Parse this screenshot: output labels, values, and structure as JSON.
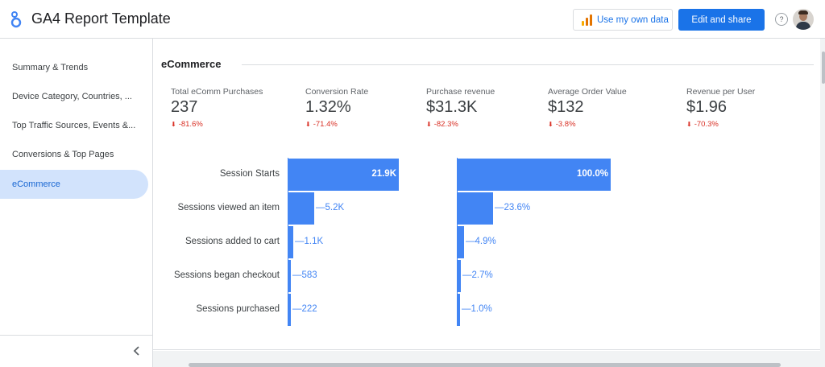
{
  "app": {
    "title": "GA4 Report Template"
  },
  "header": {
    "use_own_data_label": "Use my own data",
    "edit_share_label": "Edit and share",
    "help_label": "?",
    "accent": "#1a73e8"
  },
  "sidebar": {
    "items": [
      {
        "label": "Summary & Trends",
        "active": false
      },
      {
        "label": "Device Category, Countries, ...",
        "active": false
      },
      {
        "label": "Top Traffic Sources, Events &...",
        "active": false
      },
      {
        "label": "Conversions & Top Pages",
        "active": false
      },
      {
        "label": "eCommerce",
        "active": true
      }
    ],
    "collapse_icon": "chevron-left-icon"
  },
  "main": {
    "section_title": "eCommerce",
    "kpis": [
      {
        "label": "Total eComm Purchases",
        "value": "237",
        "delta": "-81.6%"
      },
      {
        "label": "Conversion Rate",
        "value": "1.32%",
        "delta": "-71.4%"
      },
      {
        "label": "Purchase revenue",
        "value": "$31.3K",
        "delta": "-82.3%"
      },
      {
        "label": "Average Order Value",
        "value": "$132",
        "delta": "-3.8%"
      },
      {
        "label": "Revenue per User",
        "value": "$1.96",
        "delta": "-70.3%"
      }
    ],
    "delta_color": "#d93025",
    "bar_color": "#4285f4"
  },
  "chart_data": {
    "type": "bar",
    "orientation": "horizontal",
    "categories": [
      "Session Starts",
      "Sessions viewed an item",
      "Sessions added to cart",
      "Sessions began checkout",
      "Sessions purchased"
    ],
    "series": [
      {
        "values": [
          21900,
          5200,
          1100,
          583,
          222
        ],
        "labels": [
          "21.9K",
          "5.2K",
          "1.1K",
          "583",
          "222"
        ]
      },
      {
        "values": [
          100.0,
          23.6,
          4.9,
          2.7,
          1.0
        ],
        "labels": [
          "100.0%",
          "23.6%",
          "4.9%",
          "2.7%",
          "1.0%"
        ]
      }
    ],
    "grid": false,
    "legend": "none"
  }
}
